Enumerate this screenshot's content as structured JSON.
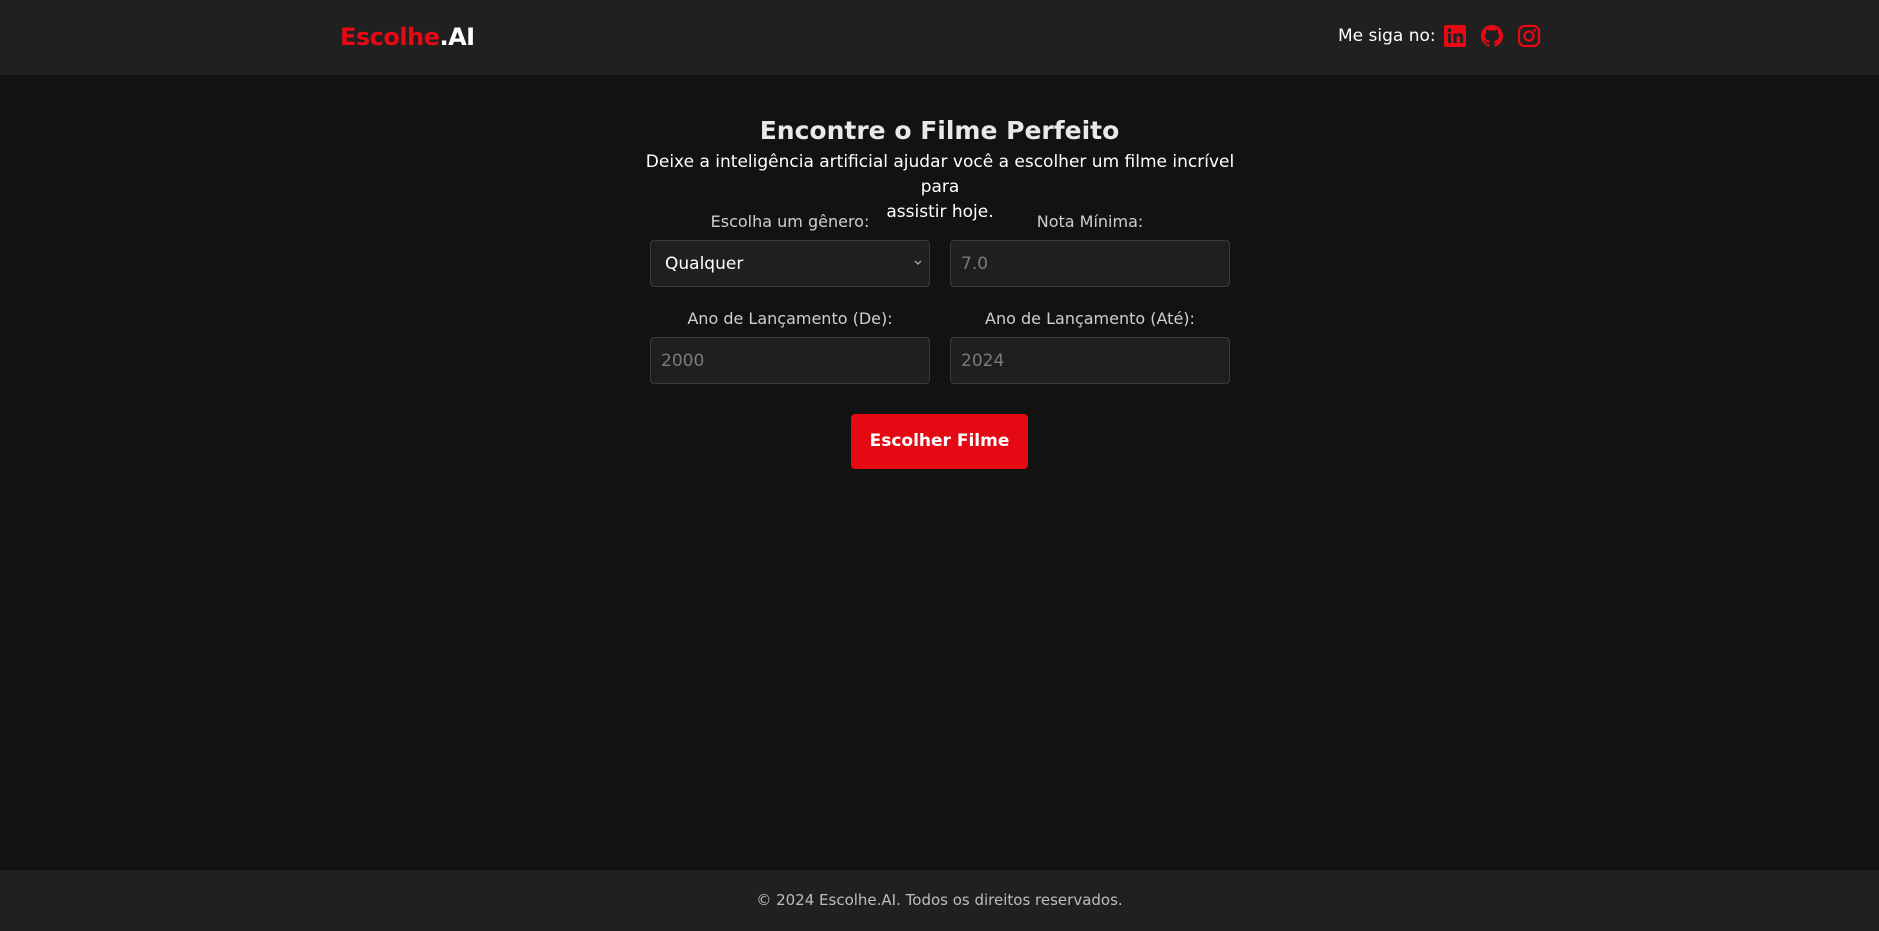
{
  "header": {
    "logo_part1": "Escolhe",
    "logo_part2": ".AI",
    "follow_text": "Me siga no:",
    "social": [
      {
        "icon": "linkedin-icon"
      },
      {
        "icon": "github-icon"
      },
      {
        "icon": "instagram-icon"
      }
    ]
  },
  "main": {
    "title": "Encontre o Filme Perfeito",
    "subtitle_line1": "Deixe a inteligência artificial ajudar você a escolher um filme incrível para",
    "subtitle_line2": "assistir hoje.",
    "genre_label": "Escolha um gênero:",
    "genre_value": "Qualquer",
    "rating_label": "Nota Mínima:",
    "rating_placeholder": "7.0",
    "year_from_label": "Ano de Lançamento (De):",
    "year_from_placeholder": "2000",
    "year_to_label": "Ano de Lançamento (Até):",
    "year_to_placeholder": "2024",
    "submit_label": "Escolher Filme"
  },
  "footer": {
    "copyright": "© 2024 Escolhe.AI. Todos os direitos reservados."
  },
  "colors": {
    "accent": "#e50914",
    "background": "#121212",
    "header_bg": "#202020",
    "input_bg": "#1f1f1f"
  }
}
